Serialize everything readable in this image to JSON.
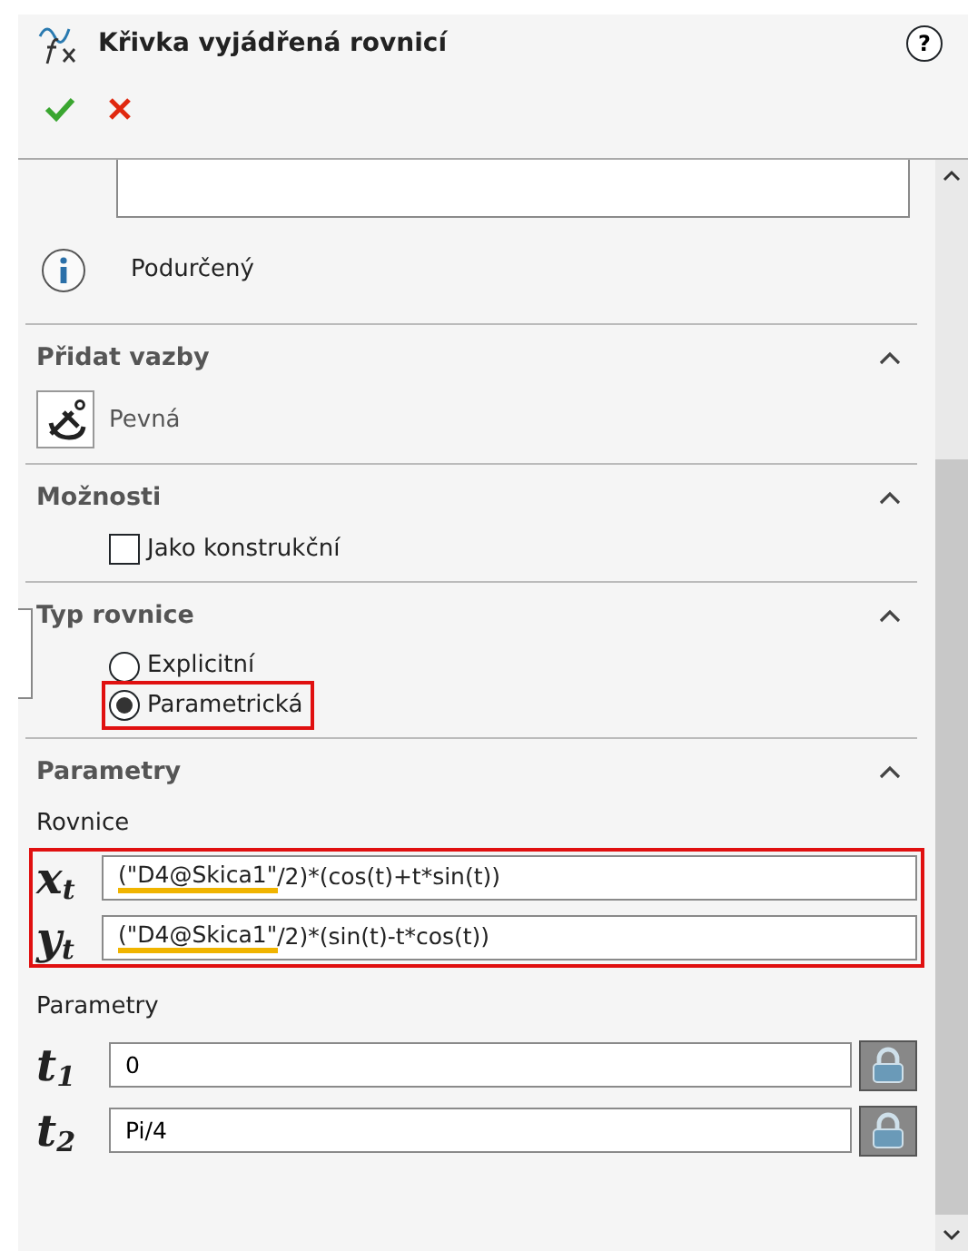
{
  "panel": {
    "title": "Křivka vyjádřená rovnicí",
    "help": "?"
  },
  "actions": [
    {
      "kind": "ok"
    },
    {
      "kind": "cancel"
    }
  ],
  "status": {
    "text": "Podurčený"
  },
  "sections": [
    {
      "kind": "relations",
      "title": "Přidat vazby",
      "expanded": true,
      "items": [
        {
          "label": "Pevná"
        }
      ]
    },
    {
      "kind": "options",
      "title": "Možnosti",
      "expanded": true,
      "items": [
        {
          "label": "Jako konstrukční",
          "checked": false
        }
      ]
    },
    {
      "kind": "type",
      "title": "Typ rovnice",
      "expanded": true,
      "items": [
        {
          "label": "Explicitní",
          "selected": false,
          "highlighted": false
        },
        {
          "label": "Parametrická",
          "selected": true,
          "highlighted": true
        }
      ]
    },
    {
      "kind": "params",
      "title": "Parametry",
      "expanded": true,
      "equations_label": "Rovnice",
      "equations_highlighted": true,
      "equations": [
        {
          "label": "x$_{t}$",
          "parts": [
            {
              "text": "(\"D4@Skica1\"",
              "underlined": true
            },
            {
              "text": "/2)*(cos(t)+t*sin(t))",
              "underlined": false
            }
          ]
        },
        {
          "label": "y$_{t}$",
          "parts": [
            {
              "text": "(\"D4@Skica1\"",
              "underlined": true
            },
            {
              "text": "/2)*(sin(t)-t*cos(t))",
              "underlined": false
            }
          ]
        }
      ],
      "params_label": "Parametry",
      "params": [
        {
          "label": "t$_{1}$",
          "value": "0"
        },
        {
          "label": "t$_{2}$",
          "value": "Pi/4"
        }
      ]
    }
  ]
}
